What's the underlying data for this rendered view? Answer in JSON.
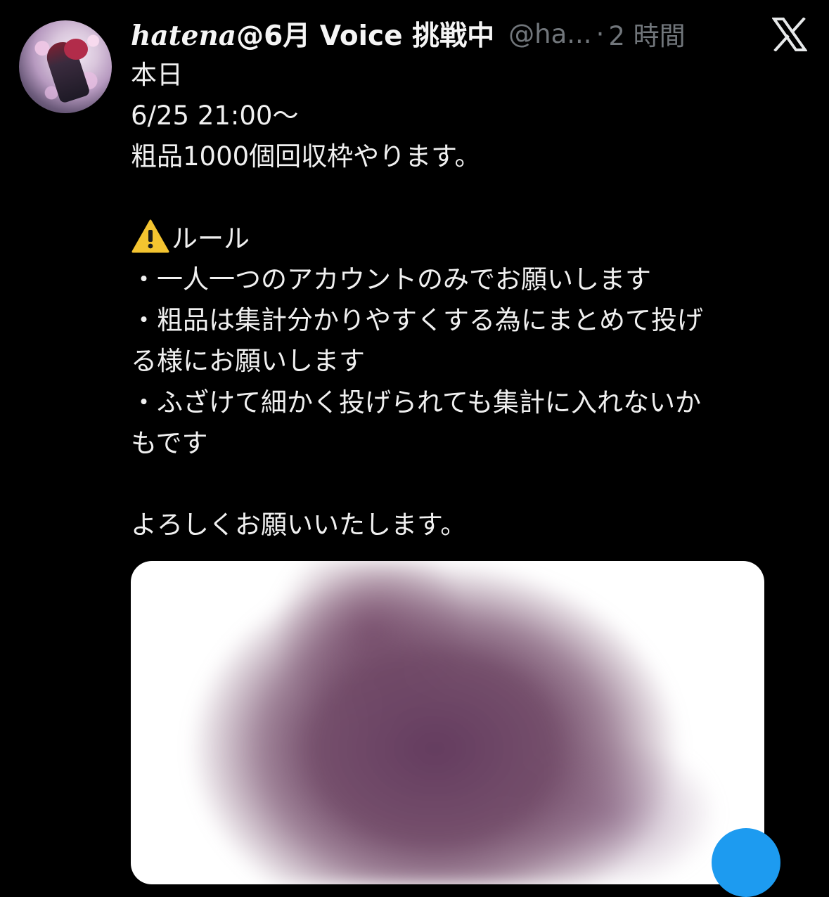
{
  "post": {
    "author": {
      "display_name_latin": "hatena",
      "display_name_rest": "@6月 Voice 挑戦中",
      "handle": "@ha...",
      "separator": "·",
      "timestamp": "2 時間",
      "avatar_icon": "avatar-image"
    },
    "brand_icon": "x-logo-icon",
    "text_lines": [
      "本日",
      "6/25  21:00～",
      "粗品1000個回収枠やります。",
      "",
      "ルール",
      "・一人一つのアカウントのみでお願いします",
      "・粗品は集計分かりやすくする為にまとめて投げ",
      "る様にお願いします",
      "・ふざけて細かく投げられても集計に入れないか",
      "もです",
      "",
      "よろしくお願いいたします。"
    ],
    "warning_icon": "warning-icon",
    "media": {
      "icon": "blurred-image"
    }
  },
  "colors": {
    "background": "#000000",
    "text": "#e7e9ea",
    "muted": "#71767b",
    "accent": "#1d9bf0",
    "warning": "#f4c430"
  }
}
